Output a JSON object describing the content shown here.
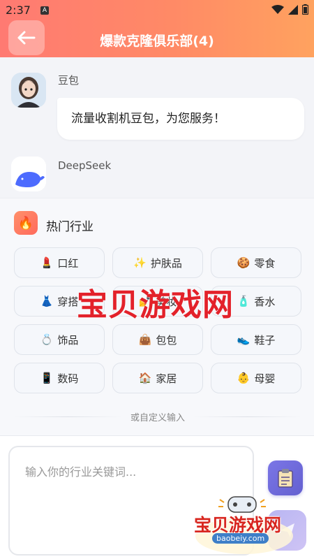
{
  "status_bar": {
    "time": "2:37",
    "app_icon_letter": "A"
  },
  "header": {
    "title": "爆款克隆俱乐部(4)"
  },
  "chat": {
    "messages": [
      {
        "sender": "豆包",
        "text": "流量收割机豆包，为您服务！"
      },
      {
        "sender": "DeepSeek"
      }
    ]
  },
  "industry": {
    "title": "热门行业",
    "items": [
      {
        "emoji": "💄",
        "label": "口红"
      },
      {
        "emoji": "✨",
        "label": "护肤品"
      },
      {
        "emoji": "🍪",
        "label": "零食"
      },
      {
        "emoji": "👗",
        "label": "穿搭"
      },
      {
        "emoji": "💅",
        "label": "美妆"
      },
      {
        "emoji": "🧴",
        "label": "香水"
      },
      {
        "emoji": "💍",
        "label": "饰品"
      },
      {
        "emoji": "👜",
        "label": "包包"
      },
      {
        "emoji": "👟",
        "label": "鞋子"
      },
      {
        "emoji": "📱",
        "label": "数码"
      },
      {
        "emoji": "🏠",
        "label": "家居"
      },
      {
        "emoji": "👶",
        "label": "母婴"
      }
    ],
    "custom_label": "或自定义输入"
  },
  "input": {
    "placeholder": "输入你的行业关键词..."
  },
  "watermark": {
    "center_text": "宝贝游戏网",
    "badge_text": "宝贝游戏网",
    "badge_url": "baobeiy.com"
  },
  "colors": {
    "header_gradient_start": "#ff7a72",
    "header_gradient_end": "#ffa25f",
    "accent_purple": "#6460d0",
    "watermark_red": "#e3212a"
  }
}
